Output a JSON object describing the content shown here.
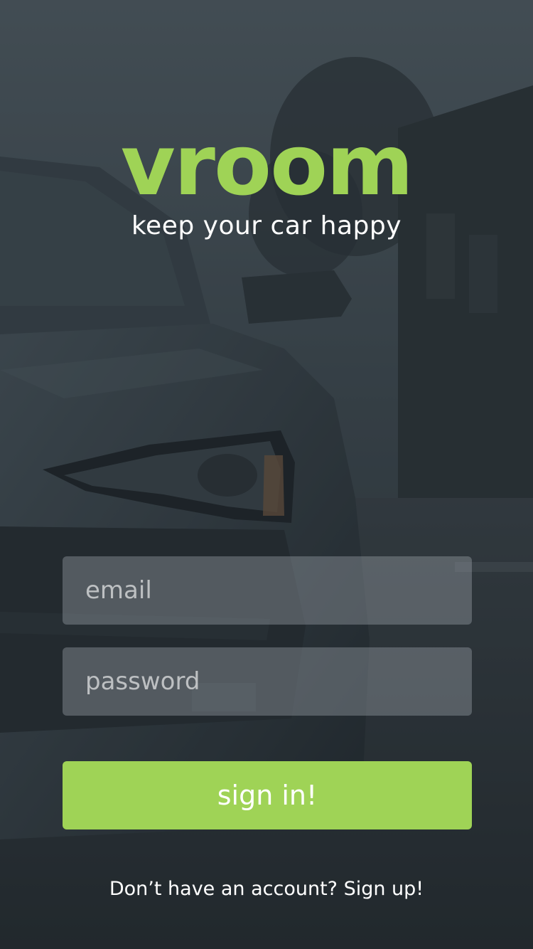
{
  "app": {
    "logo_text": "vroom",
    "tagline": "keep your car happy"
  },
  "form": {
    "email_placeholder": "email",
    "password_placeholder": "password",
    "signin_label": "sign in!"
  },
  "footer": {
    "signup_prompt": "Don’t have an account? Sign up!"
  },
  "colors": {
    "accent": "#9fd356",
    "text": "#ffffff",
    "background": "#2a3238"
  }
}
